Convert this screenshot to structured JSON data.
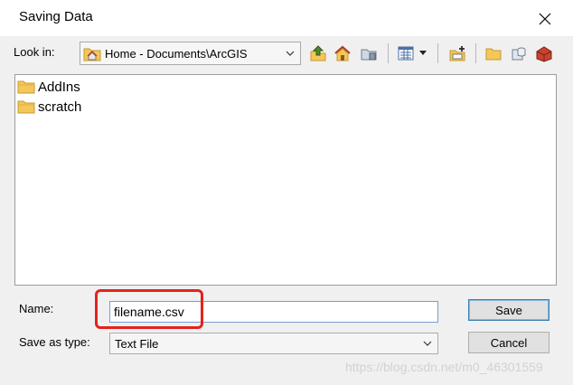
{
  "window": {
    "title": "Saving Data",
    "close_glyph": "✕"
  },
  "lookin": {
    "label": "Look in:",
    "value": "Home - Documents\\ArcGIS",
    "icon": "home-folder-icon"
  },
  "toolbar": {
    "icons": [
      "up-one-level-icon",
      "home-icon",
      "connect-folder-icon",
      "view-list-icon",
      "view-menu-arrow-icon",
      "new-item-icon",
      "new-folder-icon",
      "new-database-icon",
      "toolbox-icon"
    ]
  },
  "files": [
    {
      "name": "AddIns",
      "icon": "folder-icon"
    },
    {
      "name": "scratch",
      "icon": "folder-icon"
    }
  ],
  "name_field": {
    "label": "Name:",
    "value": "filename.csv"
  },
  "type_field": {
    "label": "Save as type:",
    "value": "Text File"
  },
  "buttons": {
    "save": "Save",
    "cancel": "Cancel"
  },
  "watermark": "https://blog.csdn.net/m0_46301559",
  "colors": {
    "highlight": "#e4231b",
    "folder": "#f3c75a",
    "folder_edge": "#c99a2e"
  }
}
